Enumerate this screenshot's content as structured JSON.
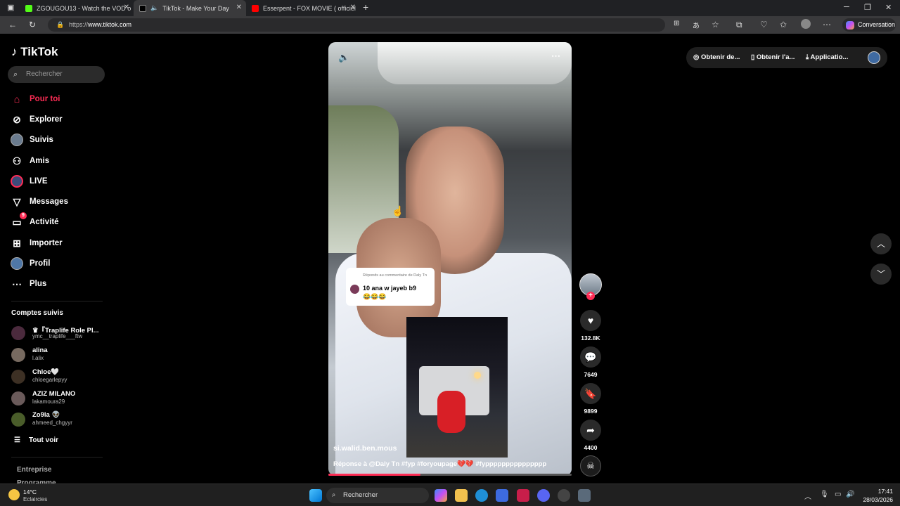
{
  "browser": {
    "tabs": [
      {
        "title": "ZGOUGOU13 - Watch the VOD o",
        "favicon_color": "#53fc18"
      },
      {
        "title": "TikTok - Make Your Day",
        "favicon_color": "#000000"
      },
      {
        "title": "Esserpent - FOX MOVIE ( officiel",
        "favicon_color": "#ff0000"
      }
    ],
    "url_scheme": "https://",
    "url_host": "www.tiktok.com",
    "conversation_label": "Conversation"
  },
  "sidebar": {
    "logo": "TikTok",
    "search_placeholder": "Rechercher",
    "nav": [
      {
        "label": "Pour toi",
        "icon": "home-icon"
      },
      {
        "label": "Explorer",
        "icon": "compass-icon"
      },
      {
        "label": "Suivis",
        "icon": "avatar-icon"
      },
      {
        "label": "Amis",
        "icon": "friends-icon"
      },
      {
        "label": "LIVE",
        "icon": "live-icon"
      },
      {
        "label": "Messages",
        "icon": "send-icon"
      },
      {
        "label": "Activité",
        "icon": "activity-icon",
        "badge": "9"
      },
      {
        "label": "Importer",
        "icon": "upload-icon"
      },
      {
        "label": "Profil",
        "icon": "profile-icon"
      },
      {
        "label": "Plus",
        "icon": "more-icon"
      }
    ],
    "followed_title": "Comptes suivis",
    "accounts": [
      {
        "name": "♛『Traplife Role Pl...",
        "handle": "ymc__traplife___ftw"
      },
      {
        "name": "alina",
        "handle": "l.alix"
      },
      {
        "name": "Chloe🤍",
        "handle": "chloegarlepyy"
      },
      {
        "name": "AZIZ MILANO",
        "handle": "lakamoura29"
      },
      {
        "name": "Zo9la 👽",
        "handle": "ahmeed_chgyyr"
      }
    ],
    "see_all": "Tout voir",
    "footer": [
      "Entreprise",
      "Programme"
    ]
  },
  "video": {
    "reply_label": "Réponds au commentaire de Daly Tn",
    "reply_text": "10 ana w jayeb b9",
    "reply_emoji": "😂😂😂",
    "author": "si.walid.ben.mous",
    "caption": "Réponse à @Daly Tn   #fyp #foryoupage💔💔 #fyppppppppppppppp",
    "progress": 0.38
  },
  "actions": {
    "likes": "132.8K",
    "comments": "7649",
    "saves": "9899",
    "shares": "4400"
  },
  "topbar": {
    "items": [
      "Obtenir de...",
      "Obtenir l'a...",
      "Applicatio..."
    ]
  },
  "taskbar": {
    "temp": "14°C",
    "condition": "Eclaircies",
    "search": "Rechercher",
    "time": "17:41",
    "date": "28/03/2026"
  },
  "colors": {
    "accent": "#fe2c55"
  }
}
